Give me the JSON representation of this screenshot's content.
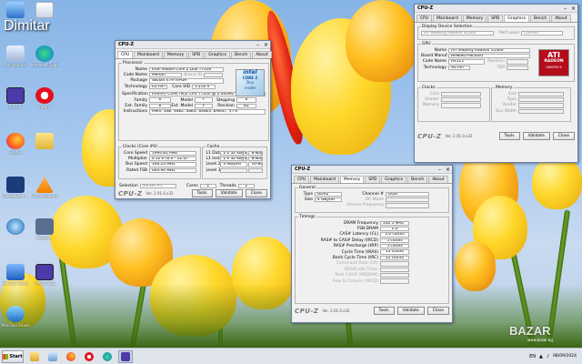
{
  "desktop": {
    "user_name": "Dimitar",
    "icons": [
      {
        "label": "",
        "icon": "computer-icon"
      },
      {
        "label": "",
        "icon": "user-folder-icon"
      },
      {
        "label": "Recycle Bin",
        "icon": "recycle-bin-icon"
      },
      {
        "label": "Microsoft Edge",
        "icon": "edge-icon"
      },
      {
        "label": "CPU-Z",
        "icon": "cpuz-icon"
      },
      {
        "label": "Opera",
        "icon": "opera-icon"
      },
      {
        "label": "Firefox",
        "icon": "firefox-icon"
      },
      {
        "label": "",
        "icon": "folder-icon"
      },
      {
        "label": "GameBoost ...",
        "icon": "gameboost-icon"
      },
      {
        "label": "VLC media player",
        "icon": "vlc-icon"
      },
      {
        "label": "",
        "icon": "network-icon"
      },
      {
        "label": "Netsky...",
        "icon": "app-icon"
      },
      {
        "label": "MiniTool Partiti...",
        "icon": "minitool-icon"
      },
      {
        "label": "CPU-Z x32",
        "icon": "cpuz-small-icon"
      },
      {
        "label": "MiniTool ShadowMaker",
        "icon": "shadowmaker-icon"
      }
    ]
  },
  "cpuz_cpu": {
    "title": "CPU-Z",
    "tabs": [
      "CPU",
      "Mainboard",
      "Memory",
      "SPD",
      "Graphics",
      "Bench",
      "About"
    ],
    "active_tab": "CPU",
    "processor_legend": "Processor",
    "name_label": "Name",
    "name": "Intel Mobile Core 2 Duo T7200",
    "codename_label": "Code Name",
    "codename": "Merom",
    "brand_id_label": "Brand ID",
    "package_label": "Package",
    "package": "Socket 479 mPGA",
    "technology_label": "Technology",
    "technology": "65 nm",
    "core_vid_label": "Core VID",
    "core_vid": "1.250 V",
    "spec_label": "Specification",
    "spec": "Intel(R) Core(TM)2 CPU     T7200 @ 2.00GHz",
    "family_label": "Family",
    "family": "6",
    "model_label": "Model",
    "model": "F",
    "stepping_label": "Stepping",
    "stepping": "6",
    "ext_family_label": "Ext. Family",
    "ext_family": "6",
    "ext_model_label": "Ext. Model",
    "ext_model": "F",
    "revision_label": "Revision",
    "revision": "B2",
    "instructions_label": "Instructions",
    "instructions": "MMX, SSE, SSE2, SSE3, SSSE3, EM64T, VT-x",
    "clocks_legend": "Clocks (Core #0)",
    "core_speed_label": "Core Speed",
    "core_speed": "1994.81 MHz",
    "multiplier_label": "Multiplier",
    "multiplier": "x 12.0 (6.0 - 12.0)",
    "bus_speed_label": "Bus Speed",
    "bus_speed": "166.23 MHz",
    "rated_fsb_label": "Rated FSB",
    "rated_fsb": "664.94 MHz",
    "cache_legend": "Cache",
    "l1d_label": "L1 Data",
    "l1d": "2 x 32 KBytes",
    "l1d_way": "8-way",
    "l1i_label": "L1 Inst.",
    "l1i": "2 x 32 KBytes",
    "l1i_way": "8-way",
    "l2_label": "Level 2",
    "l2": "4 MBytes",
    "l2_way": "16-way",
    "l3_label": "Level 3",
    "selection_label": "Selection",
    "selection": "Socket #1",
    "cores_label": "Cores",
    "cores": "2",
    "threads_label": "Threads",
    "threads": "2",
    "brand": "CPU-Z",
    "version": "Ver. 2.01.0.x32",
    "tools": "Tools",
    "validate": "Validate",
    "close": "Close",
    "logo_line1": "intel",
    "logo_line2": "CORE 2",
    "logo_line3": "Duo",
    "logo_line4": "inside"
  },
  "cpuz_graphics": {
    "title": "CPU-Z",
    "tabs": [
      "CPU",
      "Mainboard",
      "Memory",
      "SPD",
      "Graphics",
      "Bench",
      "About"
    ],
    "active_tab": "Graphics",
    "display_legend": "Display Device Selection",
    "device": "ATI Mobility Radeon X1300",
    "perf_level_label": "Perf Level",
    "perf_level": "Current",
    "gpu_legend": "GPU",
    "name_label": "Name",
    "name": "ATI Mobility Radeon X1300",
    "board_label": "Board Manuf.",
    "board": "Hewlett-Packard",
    "codename_label": "Code Name",
    "codename": "RV515",
    "revision_label": "Revision",
    "technology_label": "Technology",
    "technology": "90 nm",
    "tdp_label": "TDP",
    "clocks_legend": "Clocks",
    "core_label": "Core",
    "shader_label": "Shader",
    "memory_label": "Memory",
    "memory_legend": "Memory",
    "size_label": "Size",
    "type_label": "Type",
    "vendor_label": "Vendor",
    "bus_width_label": "Bus Width",
    "brand": "CPU-Z",
    "version": "Ver. 2.01.0.x32",
    "tools": "Tools",
    "validate": "Validate",
    "close": "Close",
    "logo_line1": "ATI",
    "logo_line2": "RADEON",
    "logo_line3": "GRAPHICS"
  },
  "cpuz_memory": {
    "title": "CPU-Z",
    "tabs": [
      "CPU",
      "Mainboard",
      "Memory",
      "SPD",
      "Graphics",
      "Bench",
      "About"
    ],
    "active_tab": "Memory",
    "general_legend": "General",
    "type_label": "Type",
    "type": "DDR2",
    "size_label": "Size",
    "size": "4 GBytes",
    "channel_label": "Channel #",
    "channel": "Dual",
    "dc_mode_label": "DC Mode",
    "uncore_label": "Uncore Frequency",
    "timings_legend": "Timings",
    "timings": [
      {
        "label": "DRAM Frequency",
        "value": "332.5 MHz"
      },
      {
        "label": "FSB:DRAM",
        "value": "1:2"
      },
      {
        "label": "CAS# Latency (CL)",
        "value": "5.0 clocks"
      },
      {
        "label": "RAS# to CAS# Delay (tRCD)",
        "value": "5 clocks"
      },
      {
        "label": "RAS# Precharge (tRP)",
        "value": "5 clocks"
      },
      {
        "label": "Cycle Time (tRAS)",
        "value": "15 clocks"
      },
      {
        "label": "Bank Cycle Time (tRC)",
        "value": "21 clocks"
      },
      {
        "label": "Command Rate (CR)",
        "value": ""
      },
      {
        "label": "DRAM Idle Timer",
        "value": ""
      },
      {
        "label": "Total CAS# (tRDRAM)",
        "value": ""
      },
      {
        "label": "Row To Column (tRCD)",
        "value": ""
      }
    ],
    "brand": "CPU-Z",
    "version": "Ver. 2.01.0.x32",
    "tools": "Tools",
    "validate": "Validate",
    "close": "Close"
  },
  "taskbar": {
    "start_label": "Start",
    "apps": [
      "file-explorer-icon",
      "folder-icon",
      "firefox-icon",
      "opera-icon",
      "edge-icon",
      "cpuz-icon"
    ],
    "lang": "EN",
    "time": "",
    "date": "08/09/2024"
  },
  "watermark": {
    "text": "BAZAR",
    "sub": "www.bazar.bg"
  }
}
